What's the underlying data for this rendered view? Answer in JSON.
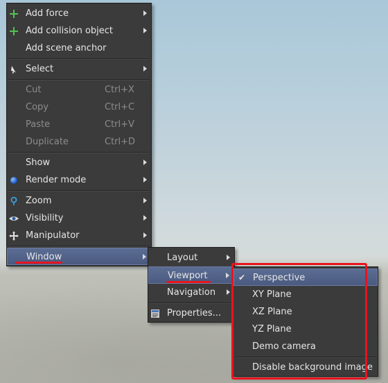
{
  "main_menu": {
    "items": [
      {
        "label": "Add force",
        "icon": "plus-icon",
        "submenu": true
      },
      {
        "label": "Add collision object",
        "icon": "plus-icon",
        "submenu": true
      },
      {
        "label": "Add scene anchor",
        "icon": "",
        "submenu": false
      },
      {
        "label": "Select",
        "icon": "cursor-icon",
        "submenu": true
      },
      {
        "label": "Cut",
        "shortcut": "Ctrl+X",
        "disabled": true
      },
      {
        "label": "Copy",
        "shortcut": "Ctrl+C",
        "disabled": true
      },
      {
        "label": "Paste",
        "shortcut": "Ctrl+V",
        "disabled": true
      },
      {
        "label": "Duplicate",
        "shortcut": "Ctrl+D",
        "disabled": true
      },
      {
        "label": "Show",
        "icon": "",
        "submenu": true
      },
      {
        "label": "Render mode",
        "icon": "sphere-icon",
        "submenu": true
      },
      {
        "label": "Zoom",
        "icon": "zoom-icon",
        "submenu": true
      },
      {
        "label": "Visibility",
        "icon": "eye-icon",
        "submenu": true
      },
      {
        "label": "Manipulator",
        "icon": "move-icon",
        "submenu": true
      },
      {
        "label": "Window",
        "icon": "",
        "submenu": true,
        "highlighted": true
      }
    ]
  },
  "window_menu": {
    "items": [
      {
        "label": "Layout",
        "submenu": true
      },
      {
        "label": "Viewport",
        "submenu": true,
        "highlighted": true
      },
      {
        "label": "Navigation",
        "submenu": true
      },
      {
        "label": "Properties...",
        "icon": "properties-icon",
        "submenu": false
      }
    ]
  },
  "viewport_menu": {
    "items": [
      {
        "label": "Perspective",
        "checked": true,
        "highlighted": true
      },
      {
        "label": "XY Plane",
        "checked": false
      },
      {
        "label": "XZ Plane",
        "checked": false
      },
      {
        "label": "YZ Plane",
        "checked": false
      },
      {
        "label": "Demo camera",
        "checked": false
      },
      {
        "label": "Disable background image",
        "checked": false
      }
    ]
  },
  "colors": {
    "menu_bg": "#3b3b3b",
    "highlight": "#52638b",
    "annotation_red": "#e8141e",
    "plus_green": "#52c252",
    "disabled_text": "#8c8c8c"
  }
}
